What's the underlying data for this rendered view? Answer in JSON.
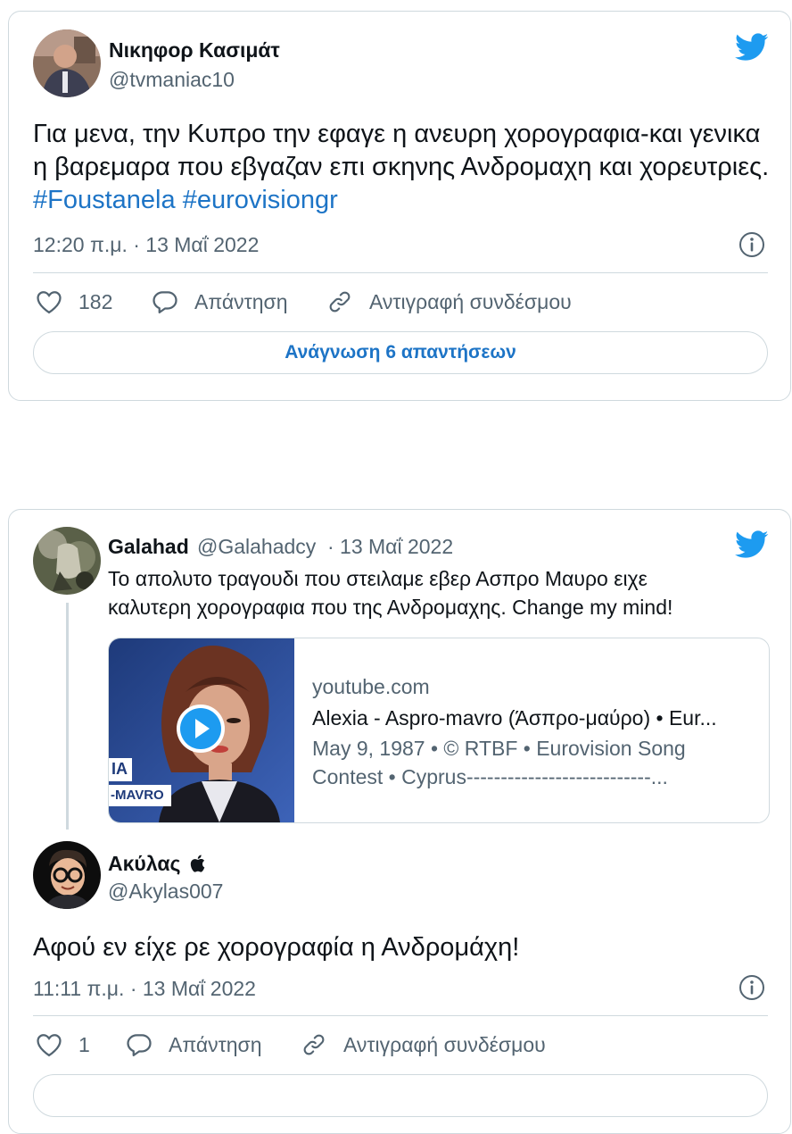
{
  "tweet1": {
    "author_name": "Νικηφορ Κασιμάτ",
    "author_handle": "@tvmaniac10",
    "text_plain": "Για μενα, την Κυπρο την εφαγε η ανευρη χορογραφια-και γενικα η βαρεμαρα που εβγαζαν επι σκηνης Ανδρομαχη και χορευτριες. ",
    "hashtags": [
      "#Foustanela",
      "#eurovisiongr"
    ],
    "timestamp": "12:20 π.μ. · 13 Μαΐ 2022",
    "like_count": "182",
    "reply_label": "Απάντηση",
    "copy_link_label": "Αντιγραφή συνδέσμου",
    "read_replies_label": "Ανάγνωση 6 απαντήσεων"
  },
  "tweet2": {
    "parent": {
      "author_name": "Galahad",
      "author_handle": "@Galahadcy",
      "date": "· 13 Μαΐ 2022",
      "text": "Το απολυτο τραγουδι που στειλαμε εβερ Ασπρο Μαυρο ειχε καλυτερη χορογραφια που της Ανδρομαχης. Change my mind!",
      "link_card": {
        "domain": "youtube.com",
        "title": "Alexia - Aspro-mavro (Άσπρο-μαύρο) • Eur...",
        "description_line1": "May 9, 1987 • © RTBF • Eurovision Song",
        "description_line2": "Contest • Cyprus---------------------------...",
        "thumb_caption_top": "IA",
        "thumb_caption_bottom": "-MAVRO"
      }
    },
    "author_name": "Ακύλας",
    "author_badge": "",
    "author_handle": "@Akylas007",
    "text": "Αφού εν είχε ρε χορογραφία η Ανδρομάχη!",
    "timestamp": "11:11 π.μ. · 13 Μαΐ 2022",
    "like_count": "1",
    "reply_label": "Απάντηση",
    "copy_link_label": "Αντιγραφή συνδέσμου"
  },
  "icons": [
    "twitter-bird-icon",
    "info-icon",
    "heart-icon",
    "reply-bubble-icon",
    "link-icon",
    "play-icon",
    "apple-icon"
  ],
  "colors": {
    "brand": "#1d9bf0",
    "link": "#1d74c6",
    "muted": "#536471",
    "border": "#cfd9de"
  }
}
